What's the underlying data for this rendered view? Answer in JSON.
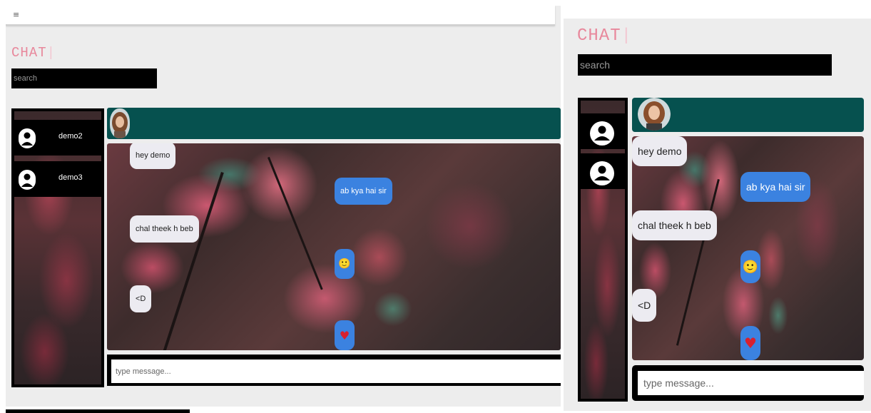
{
  "left_panel": {
    "brand": "CHAT",
    "brand_caret": "|",
    "menu_icon": "≡",
    "search": {
      "placeholder": "search"
    },
    "contacts": [
      {
        "name": "demo2"
      },
      {
        "name": "demo3"
      }
    ],
    "messages": [
      {
        "side": "in",
        "text": "hey demo"
      },
      {
        "side": "out",
        "text": "ab kya hai sir"
      },
      {
        "side": "in",
        "text": "chal theek h beb"
      },
      {
        "side": "out",
        "text": "🙂",
        "emoji": "smile-emoji"
      },
      {
        "side": "in",
        "text": "<D"
      },
      {
        "side": "out",
        "text": "♥",
        "emoji": "heart-emoji"
      }
    ],
    "composer": {
      "placeholder": "type message..."
    }
  },
  "right_panel": {
    "brand": "CHAT",
    "brand_caret": "|",
    "search": {
      "placeholder": "search"
    },
    "messages": [
      {
        "side": "in",
        "text": "hey demo"
      },
      {
        "side": "out",
        "text": "ab kya hai sir"
      },
      {
        "side": "in",
        "text": "chal theek h beb"
      },
      {
        "side": "out",
        "text": "🙂",
        "emoji": "smile-emoji"
      },
      {
        "side": "in",
        "text": "<D"
      },
      {
        "side": "out",
        "text": "♥",
        "emoji": "heart-emoji"
      }
    ],
    "composer": {
      "placeholder": "type message..."
    }
  },
  "colors": {
    "brand": "#e8889c",
    "header": "#06514f",
    "bubble_in": "#ecebf1",
    "bubble_out": "#3b82e0",
    "heart": "#d8202e",
    "smile": "#f5c518"
  },
  "icons": {
    "menu": "hamburger-menu-icon",
    "contact": "user-icon",
    "avatar": "profile-photo"
  }
}
